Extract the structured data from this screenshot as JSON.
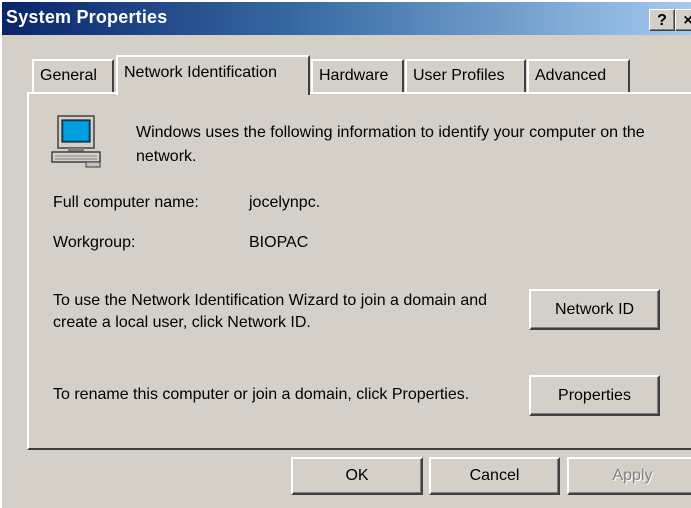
{
  "window": {
    "title": "System Properties",
    "help_label": "?",
    "close_label": "×"
  },
  "tabs": [
    {
      "label": "General"
    },
    {
      "label": "Network Identification",
      "active": true
    },
    {
      "label": "Hardware"
    },
    {
      "label": "User Profiles"
    },
    {
      "label": "Advanced"
    }
  ],
  "panel": {
    "icon": "computer-icon",
    "intro": "Windows uses the following information to identify your computer on the network.",
    "full_name_label": "Full computer name:",
    "full_name_value": "jocelynpc.",
    "workgroup_label": "Workgroup:",
    "workgroup_value": "BIOPAC",
    "wizard_text": "To use the Network Identification Wizard to join a domain and create a local user, click Network ID.",
    "network_id_button": "Network ID",
    "rename_text": "To rename this computer or join a domain, click Properties.",
    "properties_button": "Properties"
  },
  "footer": {
    "ok": "OK",
    "cancel": "Cancel",
    "apply": "Apply"
  }
}
